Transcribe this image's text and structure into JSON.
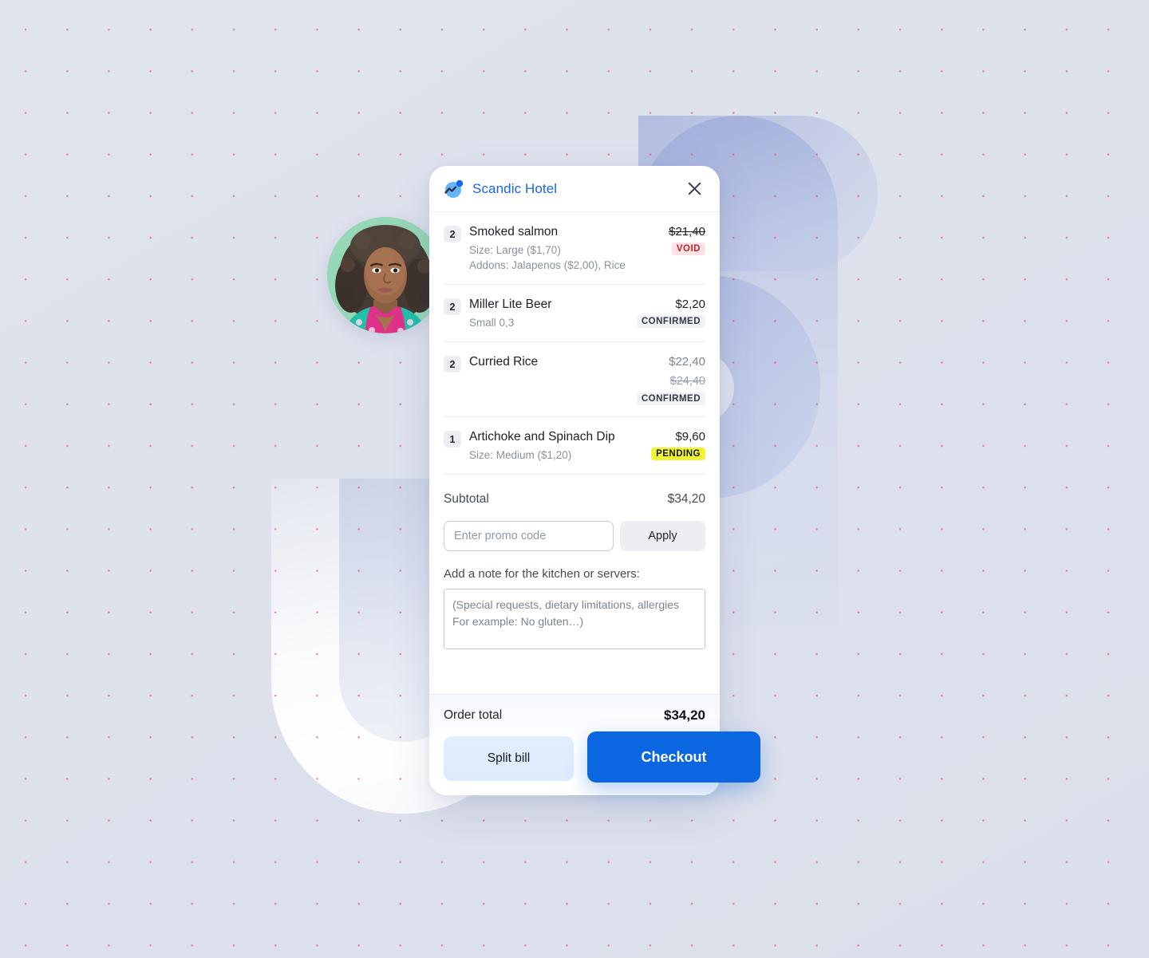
{
  "brand": {
    "name": "Scandic Hotel",
    "logo_icon": "wave-circle-logo-icon",
    "accent_color": "#1565ef"
  },
  "header": {
    "close_icon": "close-icon"
  },
  "avatar": {
    "icon": "avatar-photo-woman"
  },
  "items": [
    {
      "qty": "2",
      "name": "Smoked salmon",
      "price": "$21,40",
      "price_style": "struck",
      "old_price": "",
      "desc_lines": [
        "Size: Large ($1,70)",
        "Addons: Jalapenos ($2,00), Rice"
      ],
      "status": "VOID",
      "status_style": "void"
    },
    {
      "qty": "2",
      "name": "Miller Lite Beer",
      "price": "$2,20",
      "price_style": "normal",
      "old_price": "",
      "desc_lines": [
        "Small 0,3"
      ],
      "status": "CONFIRMED",
      "status_style": "confirmed"
    },
    {
      "qty": "2",
      "name": "Curried Rice",
      "price": "$22,40",
      "price_style": "muted",
      "old_price": "$24,40",
      "desc_lines": [],
      "status": "CONFIRMED",
      "status_style": "confirmed"
    },
    {
      "qty": "1",
      "name": "Artichoke and Spinach Dip",
      "price": "$9,60",
      "price_style": "normal",
      "old_price": "",
      "desc_lines": [
        "Size: Medium ($1,20)"
      ],
      "status": "PENDING",
      "status_style": "pending"
    }
  ],
  "subtotal": {
    "label": "Subtotal",
    "value": "$34,20"
  },
  "promo": {
    "placeholder": "Enter promo code",
    "value": "",
    "apply_label": "Apply"
  },
  "note": {
    "label": "Add a note for the kitchen or servers:",
    "placeholder": "(Special requests, dietary limitations, allergies For example: No gluten…)",
    "value": ""
  },
  "footer": {
    "total_label": "Order total",
    "total_value": "$34,20",
    "split_label": "Split bill",
    "checkout_label": "Checkout",
    "checkout_color": "#0b67e0"
  }
}
